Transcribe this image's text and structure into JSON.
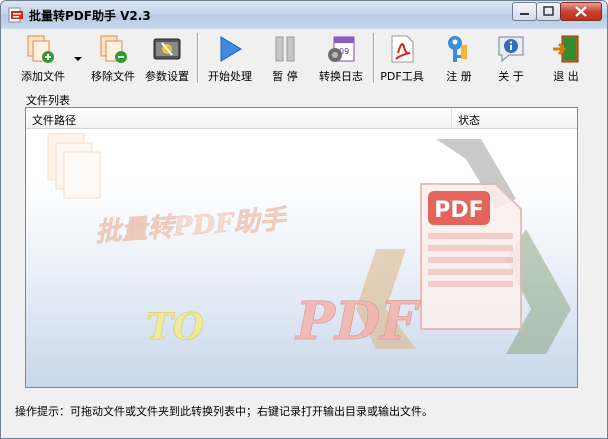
{
  "window": {
    "title": "批量转PDF助手 V2.3"
  },
  "toolbar": {
    "add_files": "添加文件",
    "remove_files": "移除文件",
    "settings": "参数设置",
    "start": "开始处理",
    "pause": "暂 停",
    "log": "转换日志",
    "pdf_tools": "PDF工具",
    "register": "注 册",
    "about": "关 于",
    "exit": "退 出"
  },
  "file_list": {
    "group_label": "文件列表",
    "columns": [
      "文件路径",
      "状态"
    ],
    "watermark_title": "批量转PDF助手",
    "watermark_to": "TO",
    "watermark_pdf": "PDF",
    "watermark_doc_label": "PDF"
  },
  "status": "操作提示：可拖动文件或文件夹到此转换列表中；右键记录打开输出目录或输出文件。",
  "colors": {
    "titlebar": "#c5d5ea",
    "close_button": "#c7422f",
    "pdf_red": "#d9261c"
  }
}
